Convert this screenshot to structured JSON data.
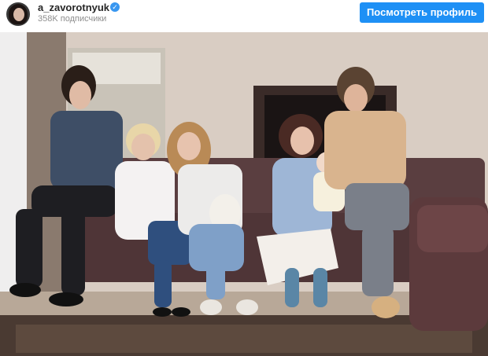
{
  "profile": {
    "username": "a_zavorotnyuk",
    "followers": "358K подписчики",
    "verified_icon": "verified-badge-icon",
    "view_profile_label": "Посмотреть профиль"
  },
  "colors": {
    "accent": "#1e90f5",
    "verified": "#3897f0"
  },
  "photo": {
    "subject": "family portrait on a sofa"
  }
}
